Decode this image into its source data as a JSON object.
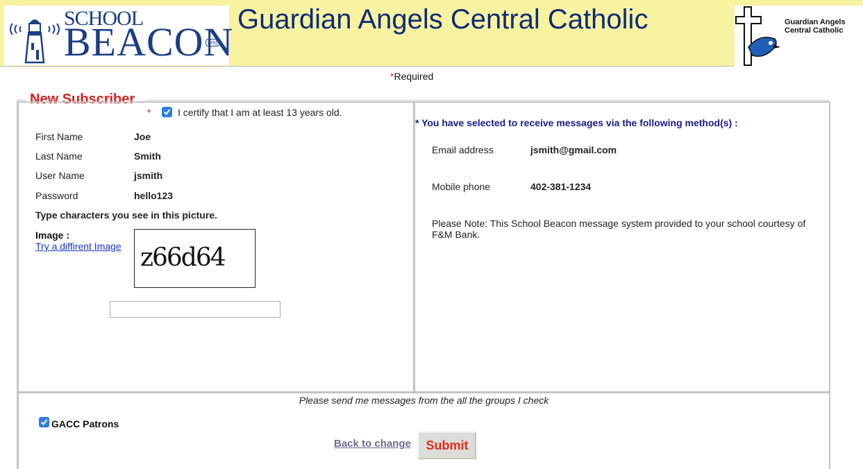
{
  "header": {
    "logo_line1": "SCHOOL",
    "logo_line2": "BEACON",
    "logo_tm": "(tm)",
    "title": "Guardian Angels Central Catholic",
    "crest_line1": "Guardian Angels",
    "crest_line2": "Central Catholic"
  },
  "required": {
    "star": "*",
    "text": "Required"
  },
  "fieldset": {
    "legend": "New Subscriber"
  },
  "certify": {
    "star": "*",
    "checked": true,
    "text": "I certify that I am at least 13 years old."
  },
  "fields": [
    {
      "label": "First Name",
      "value": "Joe"
    },
    {
      "label": "Last Name",
      "value": "Smith"
    },
    {
      "label": "User Name",
      "value": "jsmith"
    },
    {
      "label": "Password",
      "value": "hello123"
    }
  ],
  "captcha": {
    "prompt": "Type characters you see in this picture.",
    "image_label": "Image :",
    "different_link": "Try a diffirent Image",
    "image_text": "z66d64",
    "input_value": ""
  },
  "methods": {
    "title": "* You have selected to receive messages via the following method(s) :",
    "items": [
      {
        "label": "Email address",
        "value": "jsmith@gmail.com"
      },
      {
        "label": "Mobile phone",
        "value": "402-381-1234"
      }
    ],
    "note": "Please Note: This School Beacon message system provided to your school courtesy of F&M Bank."
  },
  "groups": {
    "prompt": "Please send me messages from the all the groups I check",
    "items": [
      {
        "label": "GACC Patrons",
        "checked": true
      }
    ]
  },
  "actions": {
    "back_label": "Back to change",
    "submit_label": "Submit"
  },
  "colors": {
    "header_bg": "#f7f3a0",
    "title": "#0f2a78",
    "accent_red": "#d62020",
    "checkbox": "#2b7de1",
    "methods_title": "#1a1a8a"
  }
}
